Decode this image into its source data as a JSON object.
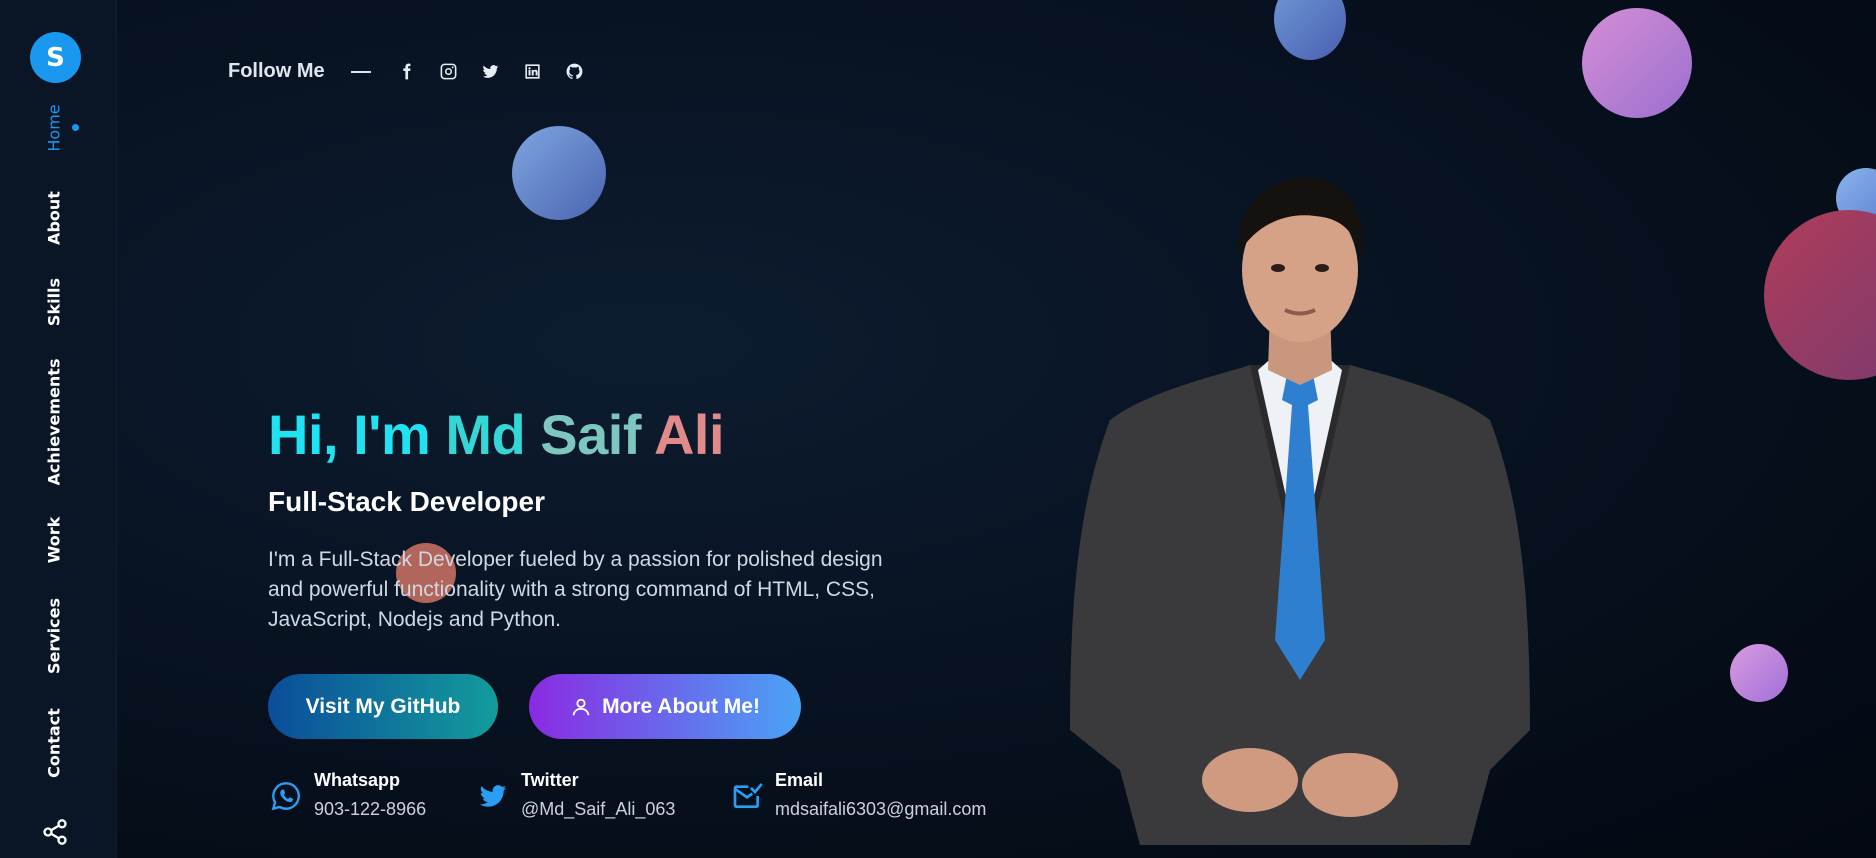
{
  "sidebar": {
    "logo_letter": "S",
    "items": [
      {
        "label": "Home"
      },
      {
        "label": "About"
      },
      {
        "label": "Skills"
      },
      {
        "label": "Achievements"
      },
      {
        "label": "Work"
      },
      {
        "label": "Services"
      },
      {
        "label": "Contact"
      }
    ],
    "active_item": "Home"
  },
  "follow": {
    "label": "Follow Me",
    "icons": [
      "facebook-icon",
      "instagram-icon",
      "twitter-icon",
      "linkedin-icon",
      "github-icon"
    ]
  },
  "hero": {
    "greeting_1": "Hi,",
    "greeting_2": "I'm",
    "name_1": "Md",
    "name_2": "Saif",
    "name_3": "Ali",
    "role": "Full-Stack Developer",
    "description": "I'm a Full-Stack Developer fueled by a passion for polished design and powerful functionality with a strong command of HTML, CSS, JavaScript, Nodejs and Python."
  },
  "buttons": {
    "github_label": "Visit My GitHub",
    "about_label": "More About Me!"
  },
  "contacts": [
    {
      "title": "Whatsapp",
      "value": "903-122-8966",
      "icon": "whatsapp-icon"
    },
    {
      "title": "Twitter",
      "value": "@Md_Saif_Ali_063",
      "icon": "twitter-icon"
    },
    {
      "title": "Email",
      "value": "mdsaifali6303@gmail.com",
      "icon": "email-icon"
    }
  ],
  "colors": {
    "accent": "#1a98f0",
    "sidebar_bg": "#0a1626",
    "page_bg": "#040b14"
  }
}
